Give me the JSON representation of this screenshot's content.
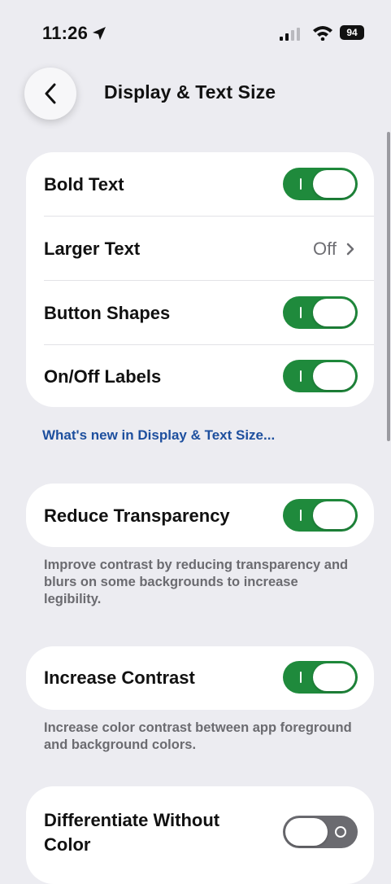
{
  "status_bar": {
    "time": "11:26",
    "battery": "94"
  },
  "nav": {
    "title": "Display & Text Size"
  },
  "card1": {
    "rows": [
      {
        "label": "Bold Text",
        "toggle": "on"
      },
      {
        "label": "Larger Text",
        "value": "Off"
      },
      {
        "label": "Button Shapes",
        "toggle": "on"
      },
      {
        "label": "On/Off Labels",
        "toggle": "on"
      }
    ]
  },
  "link_text": "What's new in Display & Text Size...",
  "reduce_transparency": {
    "label": "Reduce Transparency",
    "toggle": "on",
    "footnote": "Improve contrast by reducing transparency and blurs on some backgrounds to increase legibility."
  },
  "increase_contrast": {
    "label": "Increase Contrast",
    "toggle": "on",
    "footnote": "Increase color contrast between app foreground and background colors."
  },
  "differentiate": {
    "label": "Differentiate Without Color",
    "toggle": "off"
  },
  "colors": {
    "background": "#ececf1",
    "toggle_on": "#1f8a3c",
    "toggle_off": "#6b6b70",
    "link": "#1d4f9e"
  },
  "icons": {
    "back": "chevron-left-icon",
    "location": "location-arrow-icon",
    "signal": "cellular-signal-icon",
    "wifi": "wifi-icon",
    "chevron": "chevron-right-icon"
  }
}
